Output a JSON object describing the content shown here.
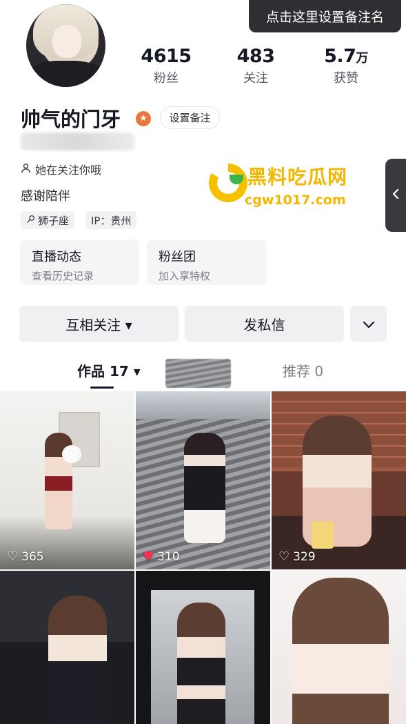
{
  "header": {
    "set_note_button": "点击这里设置备注名"
  },
  "profile": {
    "name": "帅气的门牙",
    "set_note_label": "设置备注",
    "follow_hint": "她在关注你哦",
    "bio": "感谢陪伴",
    "tags": [
      {
        "icon": "zodiac-icon",
        "label": "狮子座"
      },
      {
        "icon": "",
        "label": "IP：贵州"
      }
    ]
  },
  "stats": [
    {
      "value": "4615",
      "unit": "",
      "label": "粉丝"
    },
    {
      "value": "483",
      "unit": "",
      "label": "关注"
    },
    {
      "value": "5.7",
      "unit": "万",
      "label": "获赞"
    }
  ],
  "cards": [
    {
      "title": "直播动态",
      "subtitle": "查看历史记录"
    },
    {
      "title": "粉丝团",
      "subtitle": "加入享特权"
    }
  ],
  "actions": {
    "mutual_follow": "互相关注 ▾",
    "message": "发私信"
  },
  "tabs": {
    "works": "作品 17 ▾",
    "recommend": "推荐 0"
  },
  "watermark": {
    "title": "黑料吃瓜网",
    "url": "cgw1017.com"
  },
  "videos": [
    {
      "likes": "365",
      "liked": false
    },
    {
      "likes": "310",
      "liked": true
    },
    {
      "likes": "329",
      "liked": false
    },
    {
      "likes": "",
      "liked": false
    },
    {
      "likes": "",
      "liked": false
    },
    {
      "likes": "",
      "liked": false
    }
  ],
  "colors": {
    "accent_badge": "#e9763a",
    "liked_heart": "#fe2c55",
    "watermark": "#f2b705"
  }
}
